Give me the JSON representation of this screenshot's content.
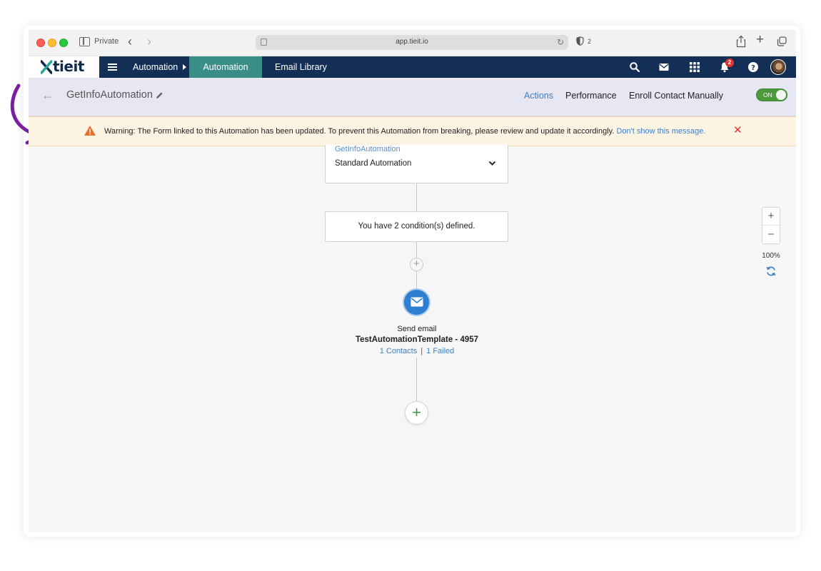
{
  "browser": {
    "private_label": "Private",
    "url": "app.tieit.io",
    "shield_count": "2"
  },
  "app": {
    "logo_text": "tieit",
    "breadcrumb": "Automation",
    "tabs": [
      {
        "label": "Automation",
        "active": true
      },
      {
        "label": "Email Library",
        "active": false
      }
    ],
    "notification_count": "2"
  },
  "subheader": {
    "title": "GetInfoAutomation",
    "nav": [
      "Actions",
      "Performance",
      "Enroll Contact Manually"
    ],
    "toggle_label": "ON",
    "toggle_on": true
  },
  "warning": {
    "text": "Warning: The Form linked to this Automation has been updated. To prevent this Automation from breaking, please review and update it accordingly.",
    "link": "Don't show this message."
  },
  "flow": {
    "trigger_name": "GetInfoAutomation",
    "trigger_type": "Standard Automation",
    "condition_text": "You have 2 condition(s) defined.",
    "action_label": "Send email",
    "template_name": "TestAutomationTemplate - 4957",
    "contacts_link": "1 Contacts",
    "stats_separator": "|",
    "failed_link": "1 Failed"
  },
  "zoom": {
    "in_label": "+",
    "out_label": "−",
    "level": "100%"
  },
  "colors": {
    "header_bg": "#142f55",
    "active_tab": "#3b8d88",
    "warning_bg": "#fdf4e3",
    "link": "#3c7fc6",
    "toggle_on": "#4c9a3c",
    "annotation_arrow": "#7a1fa2"
  }
}
